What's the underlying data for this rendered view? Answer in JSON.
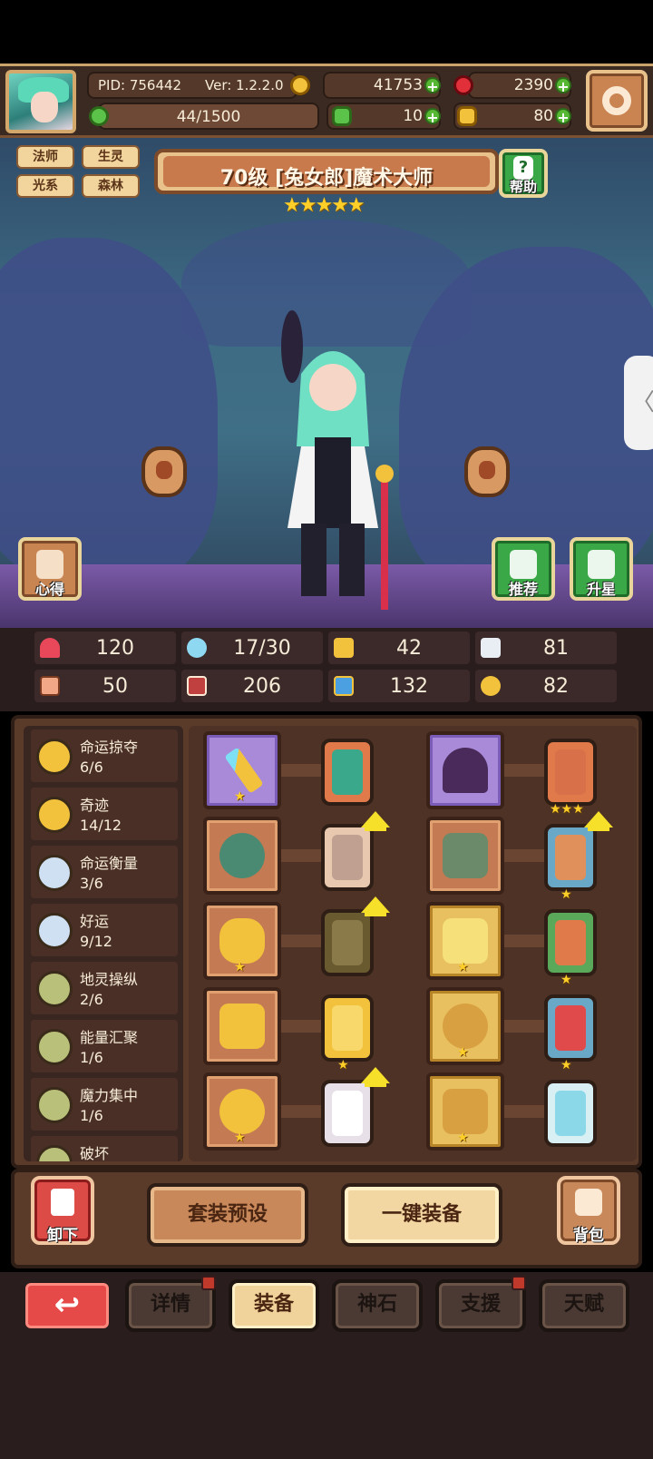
{
  "header": {
    "pid": "PID: 756442",
    "version": "Ver: 1.2.2.0",
    "gold": "41753",
    "gems": "2390",
    "exp": "44/1500",
    "clover": "10",
    "hammer": "80"
  },
  "hero": {
    "tags": [
      "法师",
      "生灵",
      "光系",
      "森林"
    ],
    "title": "70级  [兔女郎]魔术大师",
    "stars": "★★★★★",
    "help_label": "帮助",
    "insight_label": "心得",
    "recommend_label": "推荐",
    "star_up_label": "升星"
  },
  "stats": {
    "hp": "120",
    "mana": "17/30",
    "defense": "42",
    "speed": "81",
    "attack": "50",
    "magic": "206",
    "move": "132",
    "luck": "82"
  },
  "sets": [
    {
      "name": "命运掠夺",
      "count": "6/6",
      "color": "#f3c23c"
    },
    {
      "name": "奇迹",
      "count": "14/12",
      "color": "#f3c23c"
    },
    {
      "name": "命运衡量",
      "count": "3/6",
      "color": "#cfe0f2"
    },
    {
      "name": "好运",
      "count": "9/12",
      "color": "#cfe0f2"
    },
    {
      "name": "地灵操纵",
      "count": "2/6",
      "color": "#b9c07a"
    },
    {
      "name": "能量汇聚",
      "count": "1/6",
      "color": "#b9c07a"
    },
    {
      "name": "魔力集中",
      "count": "1/6",
      "color": "#b9c07a"
    },
    {
      "name": "破坏",
      "count": "",
      "color": "#b9c07a"
    }
  ],
  "actions": {
    "unload": "卸下",
    "set_preset": "套装预设",
    "one_key_equip": "一键装备",
    "bag": "背包"
  },
  "nav": {
    "back_icon": "↩",
    "details": "详情",
    "equipment": "装备",
    "god_stone": "神石",
    "support": "支援",
    "talent": "天赋"
  },
  "colors": {
    "accent": "#e8c28a",
    "gold_star": "#ffcf29",
    "green_button": "#3aa846",
    "red_button": "#e64a48"
  }
}
